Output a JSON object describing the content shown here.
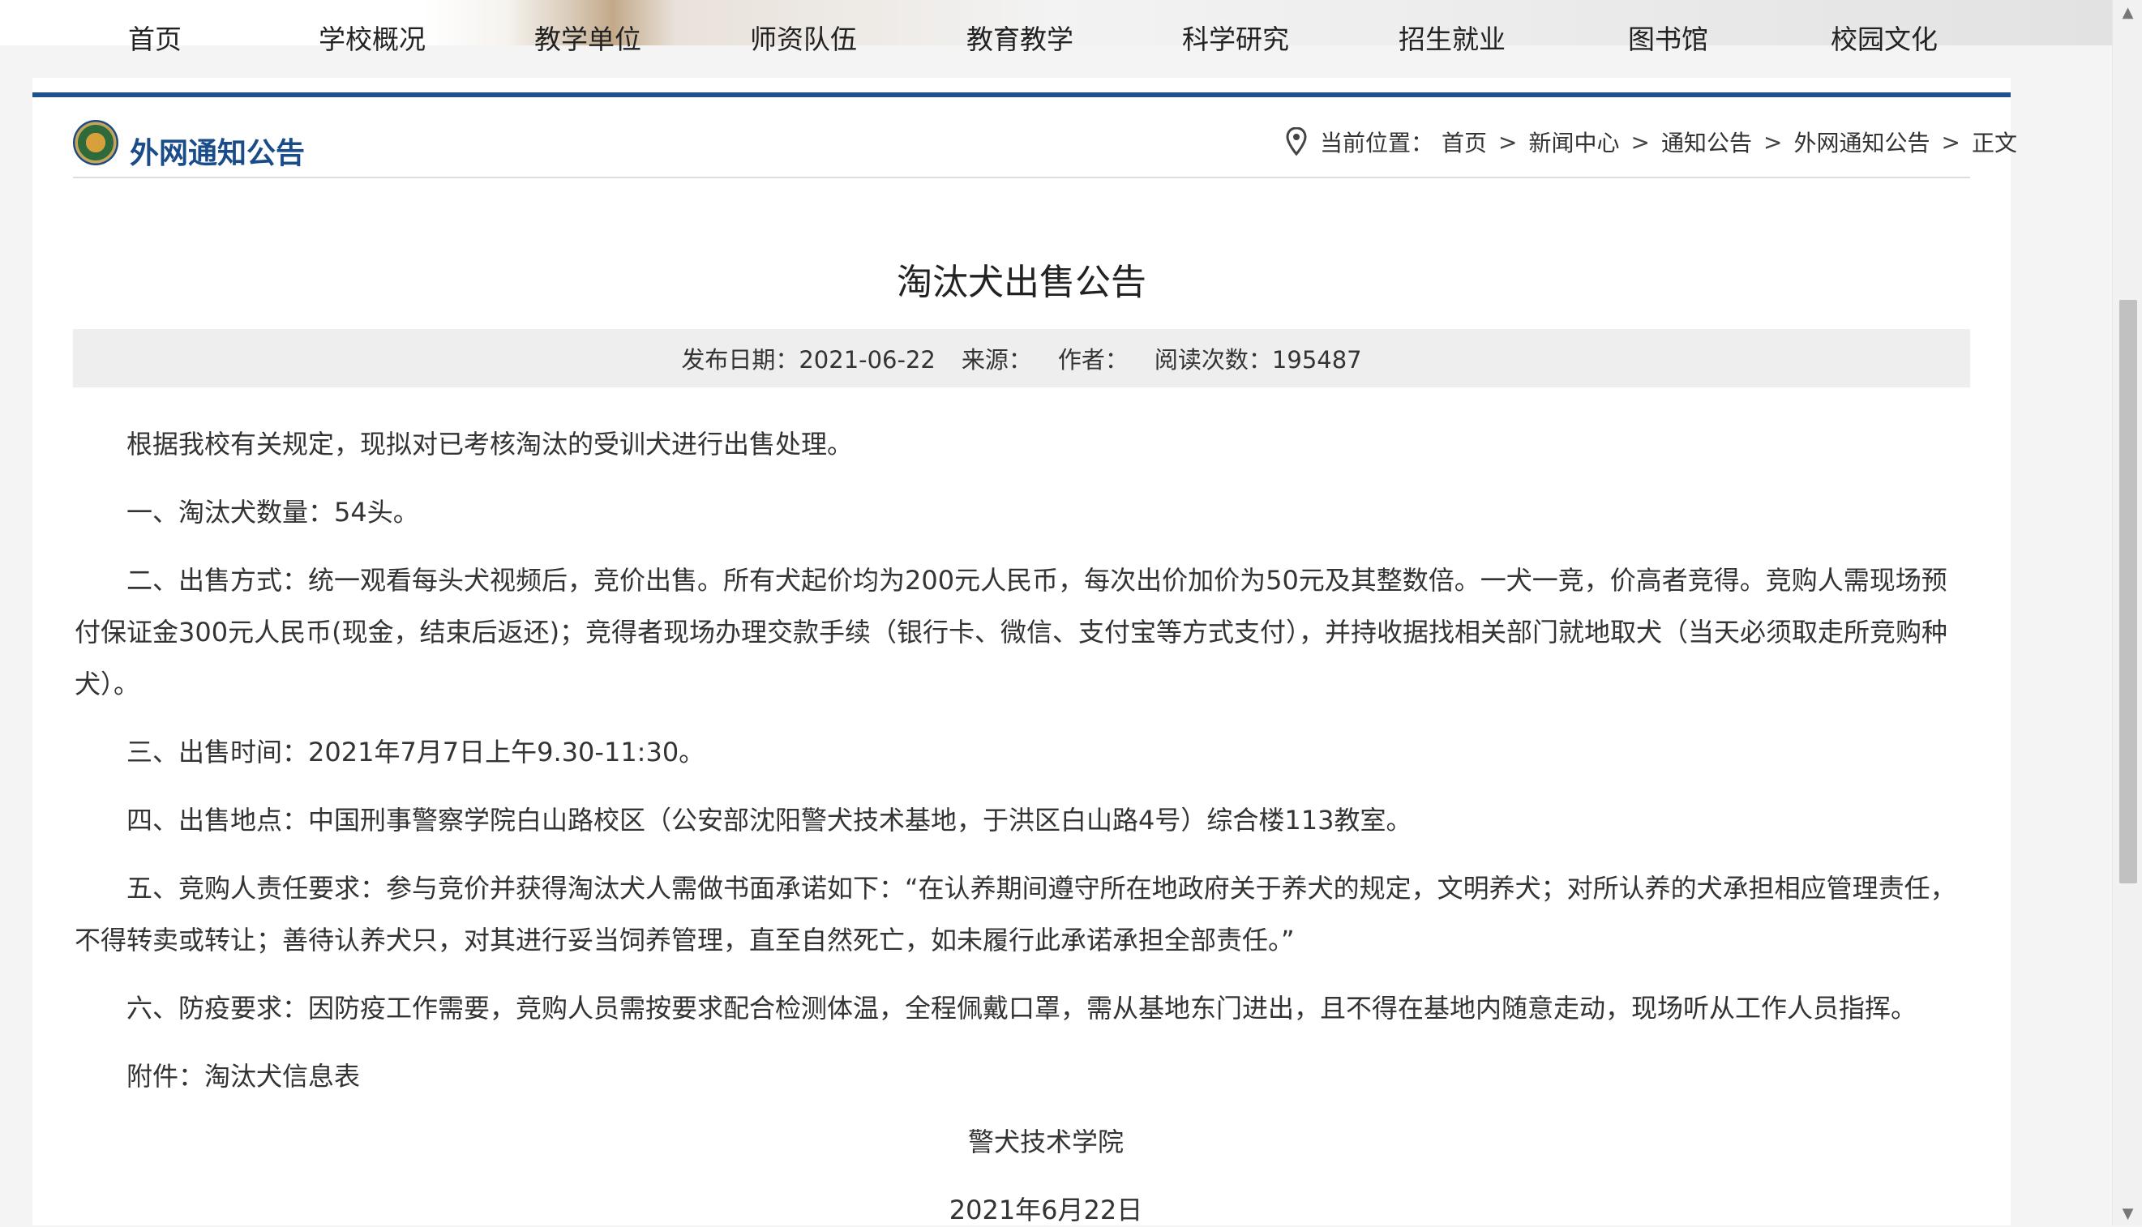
{
  "nav": {
    "items": [
      "首页",
      "学校概况",
      "教学单位",
      "师资队伍",
      "教育教学",
      "科学研究",
      "招生就业",
      "图书馆",
      "校园文化"
    ]
  },
  "section": {
    "title": "外网通知公告"
  },
  "breadcrumb": {
    "prefix": "当前位置：",
    "items": [
      "首页",
      "新闻中心",
      "通知公告",
      "外网通知公告",
      "正文"
    ],
    "separator": ">"
  },
  "article": {
    "title": "淘汰犬出售公告",
    "meta": {
      "date": "发布日期：2021-06-22",
      "source": "来源：",
      "author": "作者：",
      "reads": "阅读次数：195487"
    },
    "paragraphs": [
      "根据我校有关规定，现拟对已考核淘汰的受训犬进行出售处理。",
      "一、淘汰犬数量：54头。",
      "二、出售方式：统一观看每头犬视频后，竞价出售。所有犬起价均为200元人民币，每次出价加价为50元及其整数倍。一犬一竞，价高者竞得。竞购人需现场预付保证金300元人民币(现金，结束后返还)；竞得者现场办理交款手续（银行卡、微信、支付宝等方式支付），并持收据找相关部门就地取犬（当天必须取走所竞购种犬）。",
      "三、出售时间：2021年7月7日上午9.30-11:30。",
      "四、出售地点：中国刑事警察学院白山路校区（公安部沈阳警犬技术基地，于洪区白山路4号）综合楼113教室。",
      "五、竞购人责任要求：参与竞价并获得淘汰犬人需做书面承诺如下：“在认养期间遵守所在地政府关于养犬的规定，文明养犬；对所认养的犬承担相应管理责任，不得转卖或转让；善待认养犬只，对其进行妥当饲养管理，直至自然死亡，如未履行此承诺承担全部责任。”",
      "六、防疫要求：因防疫工作需要，竞购人员需按要求配合检测体温，全程佩戴口罩，需从基地东门进出，且不得在基地内随意走动，现场听从工作人员指挥。",
      "附件：淘汰犬信息表"
    ],
    "signature": "警犬技术学院",
    "signature_date": "2021年6月22日"
  },
  "scrollbar": {
    "up_icon": "▲",
    "down_icon": "▼"
  }
}
